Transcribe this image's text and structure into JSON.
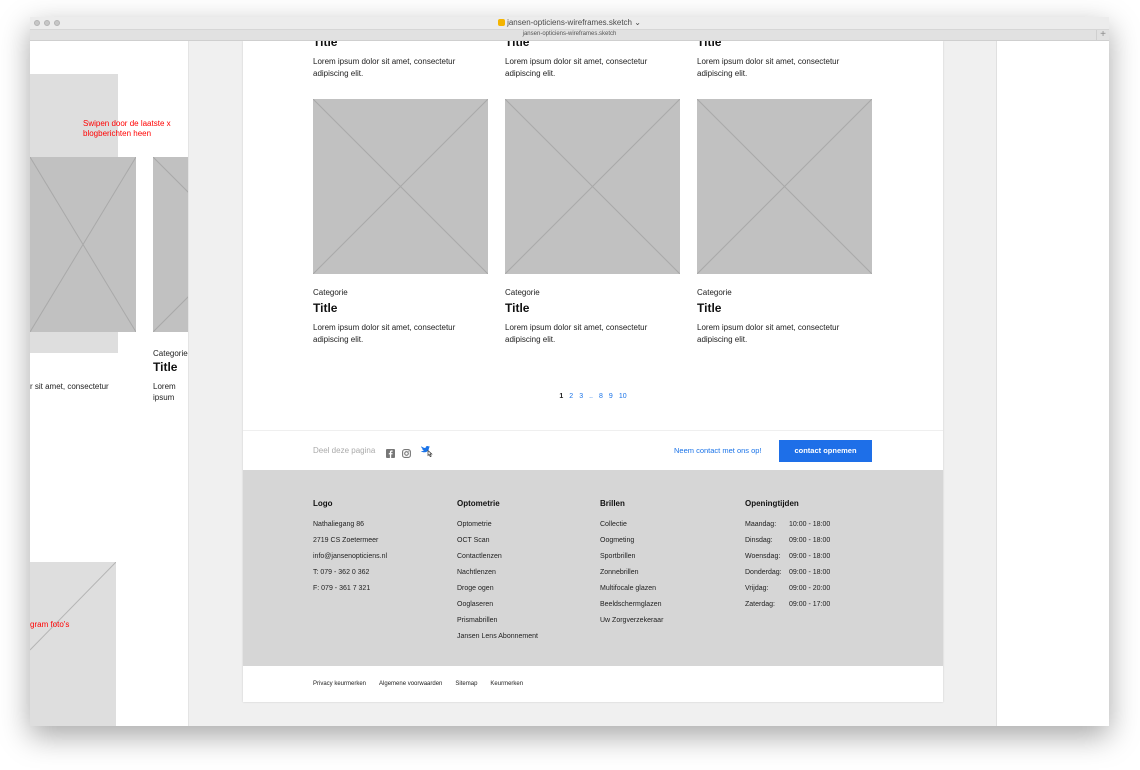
{
  "window": {
    "title": "jansen-opticiens-wireframes.sketch",
    "tab_title": "jansen-opticiens-wireframes.sketch",
    "new_tab": "+"
  },
  "left_artboard": {
    "note_top": "Swipen door de laatste x blogberichten heen",
    "note_bottom": "gram foto's",
    "card1_text": "r sit amet, consectetur",
    "card2_category": "Categorie",
    "card2_title": "Title",
    "card2_text": "Lorem ipsum dolor sit amet, consectetur adipiscing elit."
  },
  "top_row": [
    {
      "title": "Title",
      "text": "Lorem ipsum dolor sit amet, consectetur adipiscing elit."
    },
    {
      "title": "Title",
      "text": "Lorem ipsum dolor sit amet, consectetur adipiscing elit."
    },
    {
      "title": "Title",
      "text": "Lorem ipsum dolor sit amet, consectetur adipiscing elit."
    }
  ],
  "cards": [
    {
      "category": "Categorie",
      "title": "Title",
      "text": "Lorem ipsum dolor sit amet, consectetur adipiscing elit."
    },
    {
      "category": "Categorie",
      "title": "Title",
      "text": "Lorem ipsum dolor sit amet, consectetur adipiscing elit."
    },
    {
      "category": "Categorie",
      "title": "Title",
      "text": "Lorem ipsum dolor sit amet, consectetur adipiscing elit."
    }
  ],
  "pagination": [
    "1",
    "2",
    "3",
    "..",
    "8",
    "9",
    "10"
  ],
  "share": {
    "label": "Deel deze pagina",
    "icons": [
      "facebook-icon",
      "instagram-icon",
      "twitter-icon"
    ],
    "contact_link": "Neem contact met ons op!",
    "contact_button": "contact opnemen"
  },
  "footer": {
    "col1": {
      "head": "Logo",
      "lines": [
        "Nathaliegang 86",
        "2719 CS Zoetermeer",
        "info@jansenopticiens.nl",
        "T: 079 - 362 0 362",
        "F: 079 - 361 7 321"
      ]
    },
    "col2": {
      "head": "Optometrie",
      "lines": [
        "Optometrie",
        "OCT Scan",
        "Contactlenzen",
        "Nachtlenzen",
        "Droge ogen",
        "Ooglaseren",
        "Prismabrillen",
        "Jansen Lens Abonnement"
      ]
    },
    "col3": {
      "head": "Brillen",
      "lines": [
        "Collectie",
        "Oogmeting",
        "Sportbrillen",
        "Zonnebrillen",
        "Multifocale glazen",
        "Beeldschermglazen",
        "Uw Zorgverzekeraar"
      ]
    },
    "col4": {
      "head": "Openingtijden",
      "rows": [
        {
          "day": "Maandag:",
          "time": "10:00 - 18:00"
        },
        {
          "day": "Dinsdag:",
          "time": "09:00 - 18:00"
        },
        {
          "day": "Woensdag:",
          "time": "09:00 - 18:00"
        },
        {
          "day": "Donderdag:",
          "time": "09:00 - 18:00"
        },
        {
          "day": "Vrijdag:",
          "time": "09:00 - 20:00"
        },
        {
          "day": "Zaterdag:",
          "time": "09:00 - 17:00"
        }
      ]
    }
  },
  "bottom_links": [
    "Privacy keurmerken",
    "Algemene voorwaarden",
    "Sitemap",
    "Keurmerken"
  ],
  "colors": {
    "accent": "#1e6fe8",
    "link": "#1a73e8",
    "note": "#ff0000",
    "placeholder": "#c1c1c1",
    "footer": "#d6d6d6"
  }
}
